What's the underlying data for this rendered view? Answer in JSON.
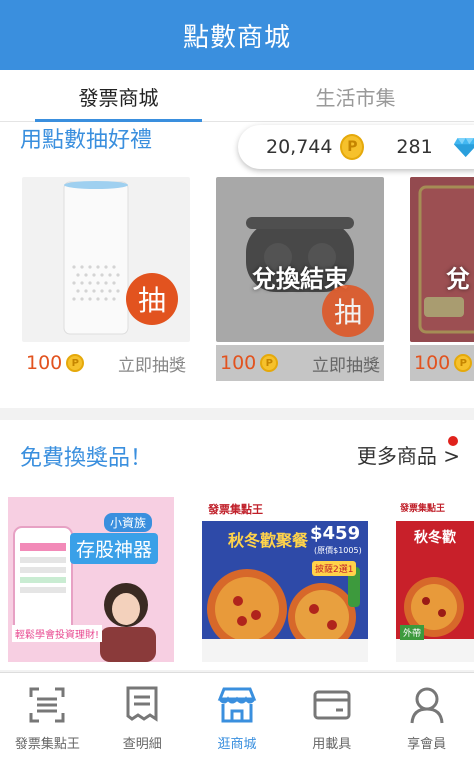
{
  "header": {
    "title": "點數商城"
  },
  "tabs": [
    {
      "label": "發票商城",
      "active": true
    },
    {
      "label": "生活市集",
      "active": false
    }
  ],
  "balance": {
    "points": "20,744",
    "points_icon": "point-coin-icon",
    "diamonds": "281",
    "diamond_icon": "diamond-icon"
  },
  "lottery": {
    "title": "用點數抽好禮",
    "cards": [
      {
        "price": "100",
        "coin": "P",
        "action": "立即抽獎",
        "badge": "抽",
        "sold_out": false
      },
      {
        "price": "100",
        "coin": "P",
        "action": "立即抽獎",
        "badge": "抽",
        "sold_out": true,
        "sold_text": "兌換結束"
      },
      {
        "price": "100",
        "coin": "P",
        "action": "",
        "badge": "",
        "sold_out": true,
        "sold_text": "兌"
      }
    ]
  },
  "prizes": {
    "title": "免費換獎品！",
    "more_label": "更多商品 >",
    "items": [
      {
        "tag": "小資族",
        "headline": "存股神器",
        "footer": "輕鬆學會投資理財!"
      },
      {
        "brand": "發票集點王",
        "headline": "秋冬歡聚餐",
        "price": "$459",
        "note": "(原價$1005)",
        "badge": "披薩2選1"
      },
      {
        "brand": "發票集點王",
        "headline": "秋冬歡",
        "badge": "外帶"
      }
    ]
  },
  "bottom_nav": [
    {
      "label": "發票集點王",
      "icon": "scan-icon",
      "active": false
    },
    {
      "label": "查明細",
      "icon": "receipt-icon",
      "active": false
    },
    {
      "label": "逛商城",
      "icon": "store-icon",
      "active": true
    },
    {
      "label": "用載具",
      "icon": "wallet-icon",
      "active": false
    },
    {
      "label": "享會員",
      "icon": "member-icon",
      "active": false
    }
  ],
  "colors": {
    "primary": "#3a8fde",
    "accent": "#e2531f",
    "coin": "#f6c12c"
  }
}
